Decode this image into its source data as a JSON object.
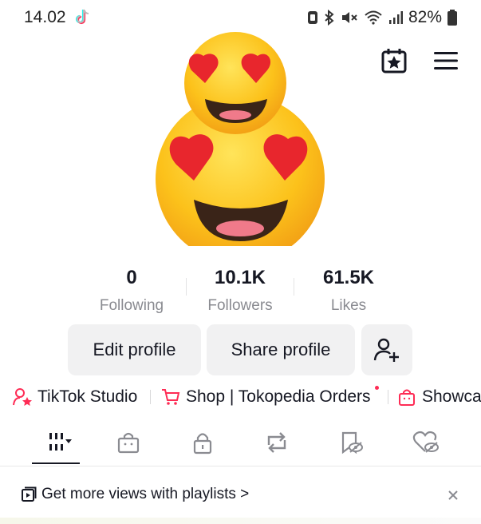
{
  "status_bar": {
    "time": "14.02",
    "battery": "82%"
  },
  "header": {
    "calendar_icon": "calendar-star-icon",
    "menu_icon": "hamburger-menu-icon"
  },
  "profile": {
    "avatar": "heart-eyes-emoji-avatar"
  },
  "stats": [
    {
      "value": "0",
      "label": "Following"
    },
    {
      "value": "10.1K",
      "label": "Followers"
    },
    {
      "value": "61.5K",
      "label": "Likes"
    }
  ],
  "buttons": {
    "edit": "Edit profile",
    "share": "Share profile",
    "add_friend_icon": "add-person-icon"
  },
  "shortcuts": [
    {
      "label": "TikTok Studio",
      "icon": "person-star-icon"
    },
    {
      "label": "Shop | Tokopedia Orders",
      "icon": "cart-icon"
    },
    {
      "label": "Showca",
      "icon": "bag-icon"
    }
  ],
  "tabs": [
    {
      "icon": "grid-videos-icon",
      "active": true
    },
    {
      "icon": "shop-bag-icon"
    },
    {
      "icon": "lock-icon"
    },
    {
      "icon": "repost-icon"
    },
    {
      "icon": "bookmark-hidden-icon"
    },
    {
      "icon": "liked-hidden-icon"
    }
  ],
  "banner": {
    "text": "Get more views with playlists >",
    "icon": "playlist-icon",
    "close_icon": "close-icon"
  },
  "colors": {
    "accent": "#fe2c55",
    "text": "#161823",
    "muted": "#8a8b91",
    "button_bg": "#f1f1f2"
  }
}
